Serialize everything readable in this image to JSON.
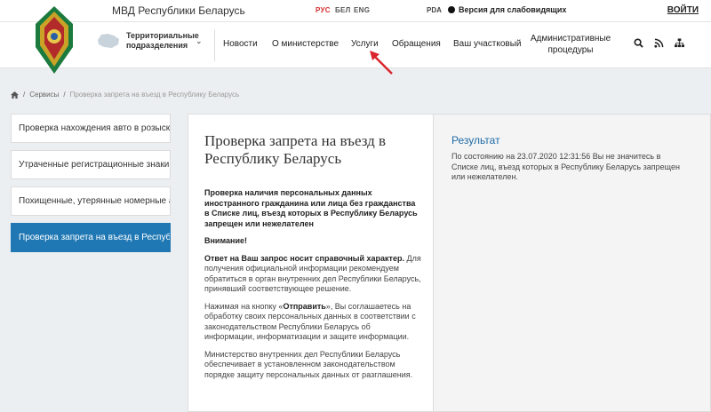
{
  "topbar": {
    "site_title": "МВД Республики Беларусь",
    "languages": [
      "РУС",
      "БЕЛ",
      "ENG"
    ],
    "pda": "PDA",
    "vision_link": "Версия для слабовидящих",
    "login": "ВОЙТИ"
  },
  "nav": {
    "territorial": "Территориальные подразделения",
    "items": [
      "Новости",
      "О министерстве",
      "Услуги",
      "Обращения",
      "Ваш участковый",
      "Административные процедуры"
    ],
    "icons": [
      "search-icon",
      "rss-icon",
      "sitemap-icon"
    ]
  },
  "breadcrumb": {
    "home_icon": "home-icon",
    "section": "Сервисы",
    "current": "Проверка запрета на въезд в Республику Беларусь"
  },
  "sidebar": {
    "items": [
      "Проверка нахождения авто в розыске",
      "Утраченные регистрационные знаки",
      "Похищенные, утерянные номерные агрегаты",
      "Проверка запрета на въезд в Республику Беларусь"
    ],
    "active_index": 3
  },
  "form": {
    "title": "Проверка запрета на въезд в Республику Беларусь",
    "intro": "Проверка наличия персональных данных иностранного гражданина или лица без гражданства в Списке лиц, въезд которых в Республику Беларусь запрещен или нежелателен",
    "attention": "Внимание!",
    "reference_bold": "Ответ на Ваш запрос носит справочный характер.",
    "reference_text": "Для получения официальной информации рекомендуем обратиться в орган внутренних дел Республики Беларусь, принявший соответствующее решение.",
    "consent_prefix": "Нажимая на кнопку «",
    "consent_button": "Отправить",
    "consent_suffix": "», Вы соглашаетесь на обработку своих персональных данных в соответствии с законодательством Республики Беларусь об информации, информатизации и защите информации.",
    "ministry": "Министерство внутренних дел Республики Беларусь обеспечивает в установленном законодательством порядке защиту персональных данных от разглашения."
  },
  "result": {
    "title": "Результат",
    "text": "По состоянию на 23.07.2020 12:31:56 Вы не значитесь в Списке лиц, въезд которых в Республику Беларусь запрещен или нежелателен."
  },
  "colors": {
    "accent": "#1f78b4",
    "lang_active": "#d32f2f",
    "arrow": "#d9262e",
    "result_title": "#1e6aa6"
  }
}
